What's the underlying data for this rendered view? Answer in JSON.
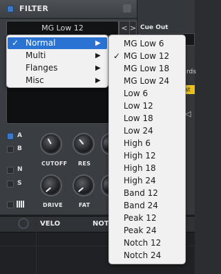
{
  "colors": {
    "accent": "#3d78c8",
    "highlight": "#2a73d2",
    "badge": "#e8c020"
  },
  "header": {
    "title": "FILTER",
    "enable_icon": "power-led-icon"
  },
  "filter_selector": {
    "value": "MG Low 12",
    "prev": "<",
    "next": ">"
  },
  "side_switches": [
    {
      "label": "A",
      "on": true
    },
    {
      "label": "B",
      "on": false
    },
    {
      "label": "N",
      "on": false
    },
    {
      "label": "S",
      "on": false
    }
  ],
  "piano_icon": "piano-keys-icon",
  "knobs": {
    "cutoff": "CUTOFF",
    "res": "RES",
    "drive": "DRIVE",
    "fat": "FAT"
  },
  "right": {
    "cue_out_label": "Cue Out",
    "partial_text": "rds",
    "badge_text": "st"
  },
  "mod_tabs": {
    "velo": "VELO",
    "note": "NOTE"
  },
  "category_menu": {
    "items": [
      {
        "check": "✓",
        "label": "Normal",
        "submenu": "▶",
        "highlighted": true
      },
      {
        "check": "",
        "label": "Multi",
        "submenu": "▶",
        "highlighted": false
      },
      {
        "check": "",
        "label": "Flanges",
        "submenu": "▶",
        "highlighted": false
      },
      {
        "check": "",
        "label": "Misc",
        "submenu": "▶",
        "highlighted": false
      }
    ]
  },
  "type_menu": {
    "items": [
      {
        "check": "",
        "label": "MG Low 6"
      },
      {
        "check": "✓",
        "label": "MG Low 12"
      },
      {
        "check": "",
        "label": "MG Low 18"
      },
      {
        "check": "",
        "label": "MG Low 24"
      },
      {
        "check": "",
        "label": "Low 6"
      },
      {
        "check": "",
        "label": "Low 12"
      },
      {
        "check": "",
        "label": "Low 18"
      },
      {
        "check": "",
        "label": "Low 24"
      },
      {
        "check": "",
        "label": "High 6"
      },
      {
        "check": "",
        "label": "High 12"
      },
      {
        "check": "",
        "label": "High 18"
      },
      {
        "check": "",
        "label": "High 24"
      },
      {
        "check": "",
        "label": "Band 12"
      },
      {
        "check": "",
        "label": "Band 24"
      },
      {
        "check": "",
        "label": "Peak 12"
      },
      {
        "check": "",
        "label": "Peak 24"
      },
      {
        "check": "",
        "label": "Notch 12"
      },
      {
        "check": "",
        "label": "Notch 24"
      }
    ]
  }
}
